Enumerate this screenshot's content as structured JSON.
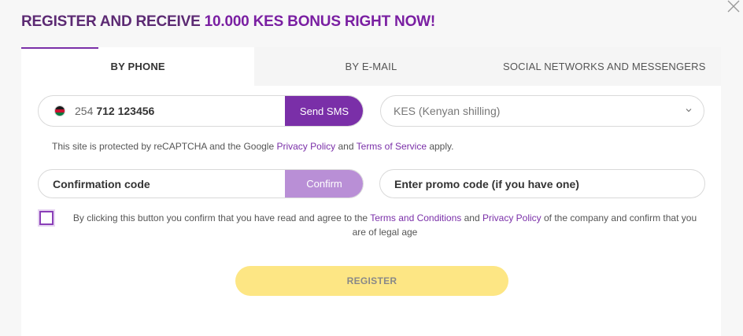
{
  "header": {
    "title_prefix": "REGISTER AND RECEIVE ",
    "title_accent": "10.000 KES BONUS RIGHT NOW!"
  },
  "tabs": [
    {
      "label": "BY PHONE",
      "active": true
    },
    {
      "label": "BY E-MAIL",
      "active": false
    },
    {
      "label": "SOCIAL NETWORKS AND MESSENGERS",
      "active": false
    }
  ],
  "phone": {
    "country_flag": "kenya-flag-icon",
    "prefix": "254",
    "number": "712 123456",
    "send_label": "Send SMS"
  },
  "currency": {
    "value": "KES (Kenyan shilling)"
  },
  "recaptcha": {
    "text_1": "This site is protected by reCAPTCHA and the Google ",
    "privacy_link": "Privacy Policy",
    "text_2": " and ",
    "terms_link": "Terms of Service",
    "text_3": " apply."
  },
  "confirmation": {
    "placeholder": "Confirmation code",
    "confirm_label": "Confirm"
  },
  "promo": {
    "placeholder": "Enter promo code (if you have one)"
  },
  "agreement": {
    "checked": false,
    "text_1": "By clicking this button you confirm that you have read and agree to the ",
    "terms_link": "Terms and Conditions",
    "text_2": " and ",
    "privacy_link": "Privacy Policy",
    "text_3": " of the company and confirm that you are of legal age"
  },
  "register": {
    "label": "REGISTER"
  },
  "colors": {
    "accent": "#7a2fa8",
    "confirm_disabled": "#b98fd6",
    "register_bg": "#fde684",
    "title": "#5c2a73"
  }
}
